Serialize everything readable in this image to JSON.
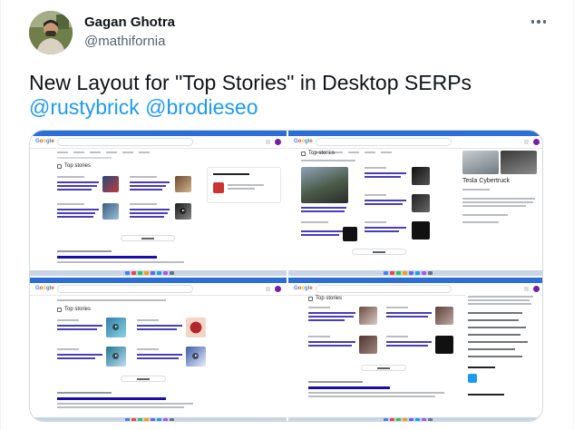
{
  "tweet": {
    "author": {
      "display_name": "Gagan Ghotra",
      "handle": "@mathifornia"
    },
    "more_icon": "more-horizontal-icon",
    "text": {
      "line1": "New Layout for \"Top Stories\" in Desktop SERPs",
      "mention1": "@rustybrick",
      "mention2": "@brodieseo"
    }
  },
  "screenshots": {
    "top_stories_label": "Top stories",
    "panel_title": "Tesla Cybertruck",
    "google_logo": "Google",
    "colors": {
      "accent": "#1d9bf0",
      "browser_bar": "#2b6ed8",
      "link": "#1a0dab"
    }
  }
}
